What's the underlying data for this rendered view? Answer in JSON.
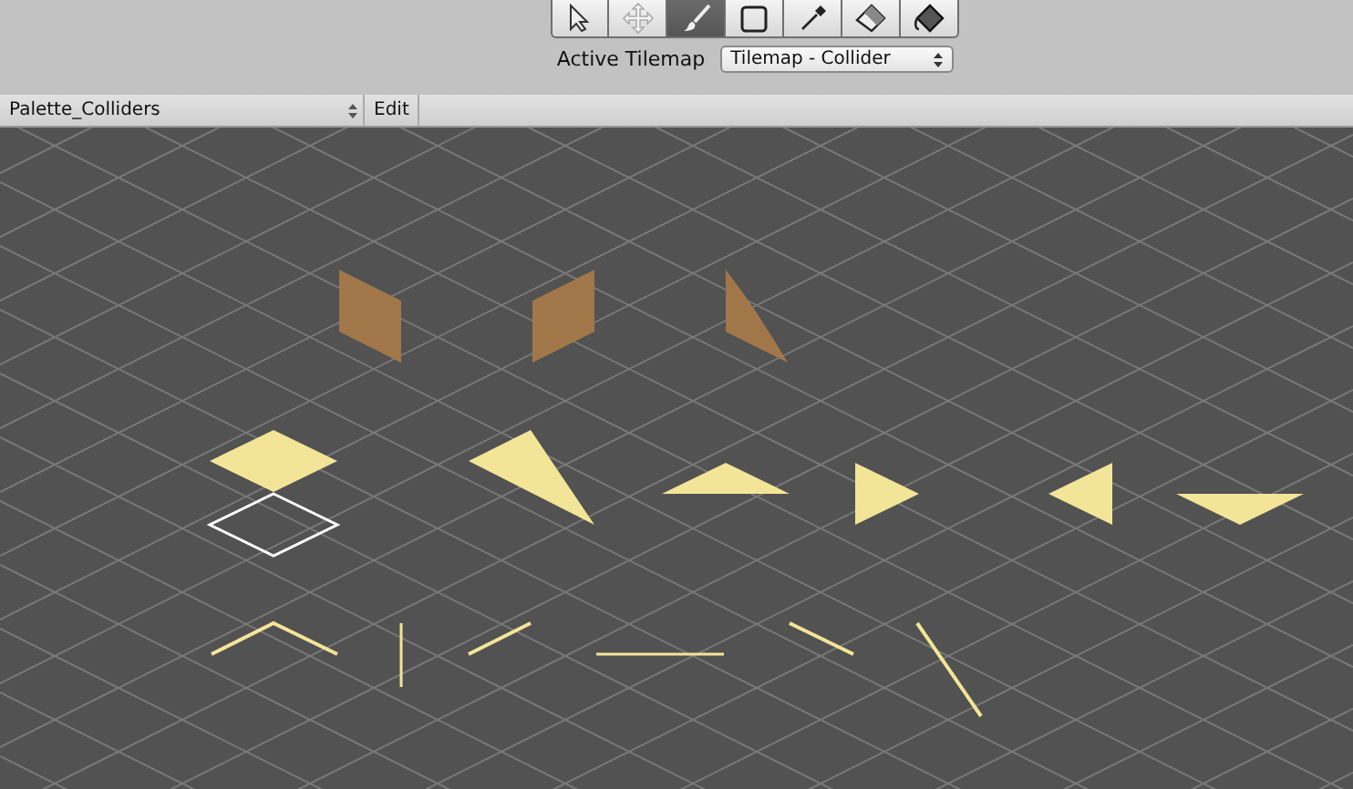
{
  "toolbar": {
    "tools": [
      {
        "kind": "select",
        "selected": false
      },
      {
        "kind": "move",
        "selected": false
      },
      {
        "kind": "paint",
        "selected": true
      },
      {
        "kind": "box",
        "selected": false
      },
      {
        "kind": "picker",
        "selected": false
      },
      {
        "kind": "erase",
        "selected": false
      },
      {
        "kind": "fill",
        "selected": false
      }
    ]
  },
  "active_tilemap": {
    "label": "Active Tilemap",
    "value": "Tilemap - Collider"
  },
  "palette_bar": {
    "palette": "Palette_Colliders",
    "edit": "Edit"
  }
}
